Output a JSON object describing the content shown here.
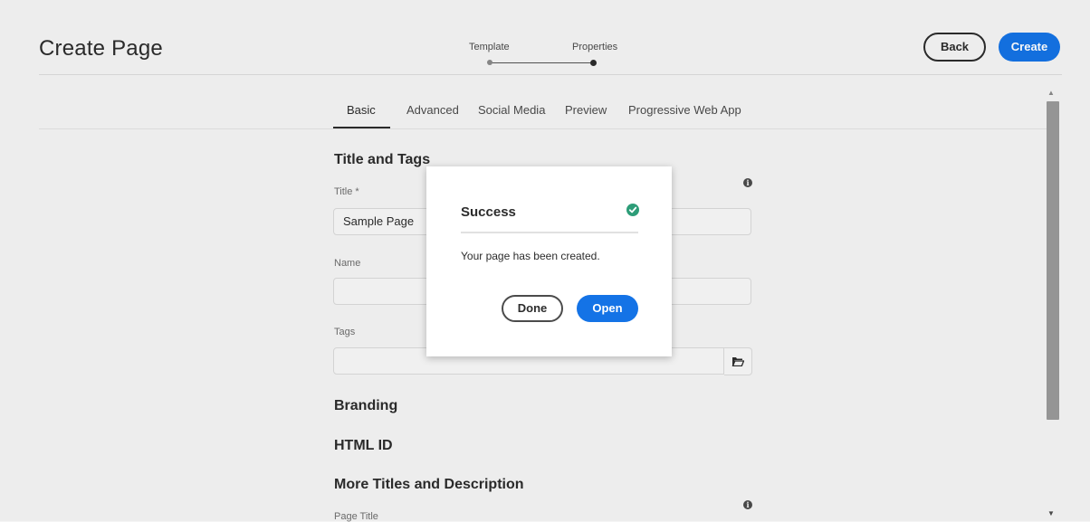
{
  "header": {
    "title": "Create Page",
    "steps": [
      "Template",
      "Properties"
    ],
    "back_label": "Back",
    "create_label": "Create"
  },
  "tabs": [
    {
      "label": "Basic",
      "active": true
    },
    {
      "label": "Advanced"
    },
    {
      "label": "Social Media"
    },
    {
      "label": "Preview"
    },
    {
      "label": "Progressive Web App"
    }
  ],
  "form": {
    "section_title_tags": "Title and Tags",
    "title_label": "Title *",
    "title_value": "Sample Page",
    "name_label": "Name",
    "name_value": "",
    "tags_label": "Tags",
    "tags_value": "",
    "section_branding": "Branding",
    "section_html_id": "HTML ID",
    "section_more_titles": "More Titles and Description",
    "page_title_label": "Page Title"
  },
  "modal": {
    "title": "Success",
    "message": "Your page has been created.",
    "done_label": "Done",
    "open_label": "Open"
  },
  "colors": {
    "accent": "#1473e6",
    "success": "#2d9d78"
  },
  "icons": {
    "info": "info-icon",
    "folder": "folder-icon",
    "check": "check-circle-icon"
  }
}
